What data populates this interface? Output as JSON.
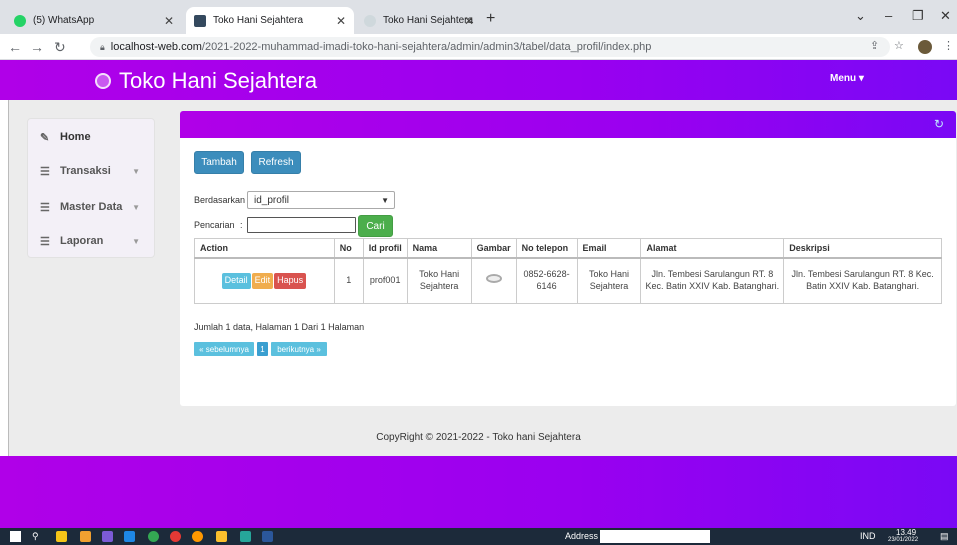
{
  "browser": {
    "tabs": [
      {
        "title": "(5) WhatsApp",
        "fav_color": "#25d366"
      },
      {
        "title": "Toko Hani Sejahtera",
        "fav_color": "#34495e"
      },
      {
        "title": "Toko Hani Sejahtera",
        "fav_color": "#cfd8dc"
      }
    ],
    "new_tab": "+",
    "url_host": "localhost-web.com",
    "url_path": "/2021-2022-muhammad-imadi-toko-hani-sejahtera/admin/admin3/tabel/data_profil/index.php"
  },
  "header": {
    "brand": "Toko Hani Sejahtera",
    "menu_label": "Menu ▾"
  },
  "sidebar": {
    "items": [
      {
        "label": "Home",
        "icon": "edit-icon"
      },
      {
        "label": "Transaksi",
        "icon": "list-icon"
      },
      {
        "label": "Master Data",
        "icon": "list-icon"
      },
      {
        "label": "Laporan",
        "icon": "list-icon"
      }
    ]
  },
  "toolbar": {
    "tambah_label": "Tambah",
    "refresh_label": "Refresh"
  },
  "filter": {
    "berdasarkan_label": "Berdasarkan :",
    "selected": "id_profil",
    "pencarian_label": "Pencarian",
    "search_value": "",
    "cari_label": "Cari"
  },
  "table": {
    "headers": [
      "Action",
      "No",
      "Id profil",
      "Nama",
      "Gambar",
      "No telepon",
      "Email",
      "Alamat",
      "Deskripsi"
    ],
    "row_actions": {
      "detail": "Detail",
      "edit": "Edit",
      "hapus": "Hapus"
    },
    "rows": [
      {
        "no": "1",
        "id_profil": "prof001",
        "nama": "Toko Hani Sejahtera",
        "no_telepon": "0852-6628-6146",
        "email": "Toko Hani Sejahtera",
        "alamat": "Jln. Tembesi Sarulangun RT. 8 Kec. Batin XXIV Kab. Batanghari.",
        "deskripsi": "Jln. Tembesi Sarulangun RT. 8 Kec. Batin XXIV Kab. Batanghari."
      }
    ]
  },
  "pagination": {
    "summary": "Jumlah 1 data, Halaman 1 Dari 1 Halaman",
    "prev": "« sebelumnya",
    "page": "1",
    "next": "berikutnya »"
  },
  "footer": {
    "copyright": "CopyRight © 2021-2022 - Toko hani Sejahtera"
  },
  "taskbar": {
    "address_label": "Address",
    "language": "IND",
    "time": "13.49",
    "date": "23/01/2022"
  },
  "colors": {
    "header_gradient_start": "#b000e8",
    "header_gradient_end": "#7a08f5",
    "primary": "#3c8dbc",
    "success": "#4cae4c"
  }
}
